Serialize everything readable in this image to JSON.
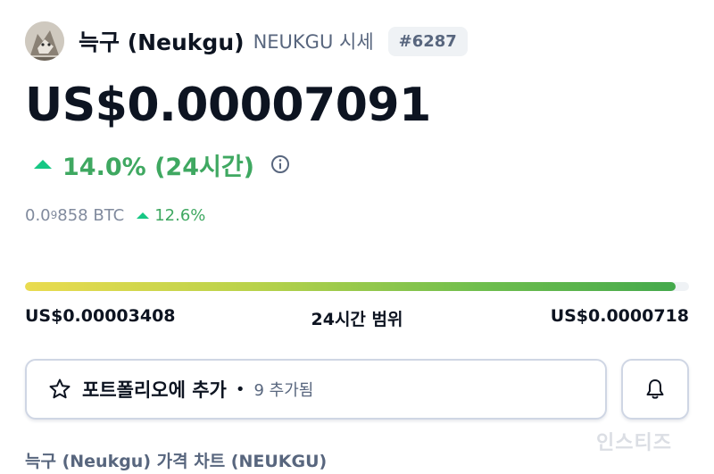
{
  "coin": {
    "name": "늑구 (Neukgu)",
    "symbol_label": "NEUKGU 시세",
    "rank": "#6287",
    "avatar_icon": "wolf-avatar-icon"
  },
  "price": {
    "usd": "US$0.00007091",
    "change_24h": "14.0% (24시간)",
    "change_direction": "up",
    "btc_prefix": "0.0",
    "btc_sub": "9",
    "btc_suffix": "858 BTC",
    "btc_change": "12.6%"
  },
  "range": {
    "low": "US$0.00003408",
    "title": "24시간 범위",
    "high": "US$0.0000718",
    "position_fraction": 0.98
  },
  "actions": {
    "portfolio_label": "포트폴리오에 추가",
    "separator": "•",
    "added_count": "9 추가됨",
    "bell_icon": "bell-icon",
    "star_icon": "star-icon"
  },
  "chart_section": {
    "title": "늑구 (Neukgu) 가격 차트 (NEUKGU)"
  },
  "watermark": "인스티즈",
  "colors": {
    "up": "#16c784",
    "up_text": "#3fa861",
    "text_primary": "#0d1421",
    "text_secondary": "#58667e",
    "border": "#cfd6e4"
  }
}
